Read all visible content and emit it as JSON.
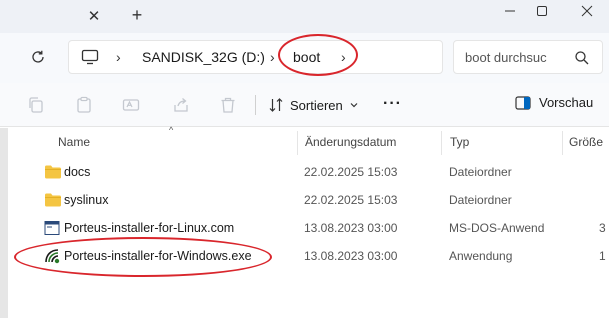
{
  "tabbar": {
    "close_glyph": "✕",
    "new_tab_glyph": "+",
    "window_controls": [
      "minimize",
      "maximize",
      "close"
    ]
  },
  "address": {
    "breadcrumbs": [
      "SANDISK_32G (D:)",
      "boot"
    ],
    "separator_glyph": "›",
    "pc_icon": "monitor-icon"
  },
  "search": {
    "placeholder": "boot durchsuc"
  },
  "toolbar": {
    "icons": [
      "copy-icon",
      "paste-icon",
      "rename-icon",
      "share-icon",
      "delete-icon"
    ],
    "sort_label": "Sortieren",
    "more_glyph": "···",
    "preview_label": "Vorschau"
  },
  "columns": {
    "name": "Name",
    "date": "Änderungsdatum",
    "type": "Typ",
    "size": "Größe"
  },
  "files": [
    {
      "name": "docs",
      "date": "22.02.2025 15:03",
      "type": "Dateiordner",
      "size": "",
      "icon": "folder-icon"
    },
    {
      "name": "syslinux",
      "date": "22.02.2025 15:03",
      "type": "Dateiordner",
      "size": "",
      "icon": "folder-icon"
    },
    {
      "name": "Porteus-installer-for-Linux.com",
      "date": "13.08.2023 03:00",
      "type": "MS-DOS-Anwend",
      "size": "3",
      "icon": "dos-app-icon"
    },
    {
      "name": "Porteus-installer-for-Windows.exe",
      "date": "13.08.2023 03:00",
      "type": "Anwendung",
      "size": "1",
      "icon": "porteus-app-icon"
    }
  ],
  "colors": {
    "annotation": "#d9262c",
    "folder": "#f4c542",
    "accent": "#0067c0"
  }
}
